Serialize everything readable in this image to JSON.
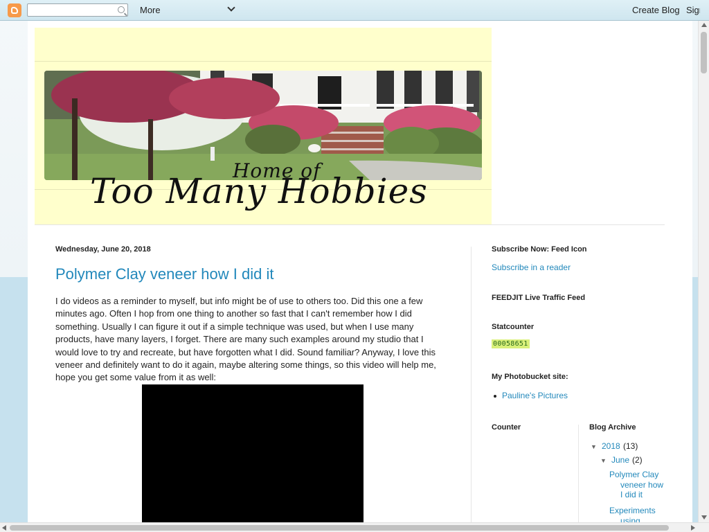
{
  "navbar": {
    "more_label": "More",
    "create_blog": "Create Blog",
    "sign_in": "Sign In"
  },
  "header": {
    "home_of": "Home of",
    "title": "Too Many Hobbies"
  },
  "post": {
    "date": "Wednesday, June 20, 2018",
    "title": "Polymer Clay veneer how I did it",
    "lines": [
      "I do videos as a reminder to myself, but info might be of use to others too.  Did this one a few",
      "minutes ago.  Often I hop from one thing to another so fast that I can't remember how I did",
      "something.  Usually I can figure it out if a simple technique was used, but when I use many",
      "products, have many layers, I forget.  There are many such examples around my studio that I",
      "would love to try and recreate, but have forgotten what I did.  Sound familiar?  Anyway, I love this",
      "veneer and definitely want to do it again, maybe altering some things, so this video will help me,",
      "hope you get some value from it as well:"
    ]
  },
  "sidebar": {
    "subscribe_heading": "Subscribe Now: Feed Icon",
    "subscribe_link": "Subscribe in a reader",
    "feedjit_heading": "FEEDJIT Live Traffic Feed",
    "statcounter_heading": "Statcounter",
    "statcounter_value": "00058651",
    "photobucket_heading": "My Photobucket site:",
    "photobucket_link": "Pauline's Pictures",
    "counter_heading": "Counter",
    "archive_heading": "Blog Archive",
    "archive": {
      "year": "2018",
      "year_count": "(13)",
      "month": "June",
      "month_count": "(2)",
      "posts": [
        "Polymer Clay veneer how I did it",
        "Experiments using"
      ]
    }
  },
  "colors": {
    "link": "#2288bb",
    "banner": "#ffffcc",
    "counter_badge": "#d9f07a",
    "logo_orange": "#f79a4a"
  }
}
